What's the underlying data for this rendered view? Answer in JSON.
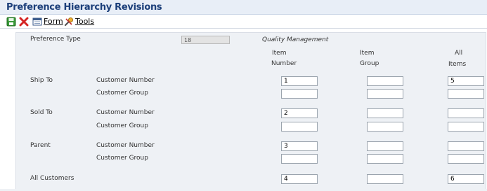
{
  "title": "Preference Hierarchy Revisions",
  "toolbar": {
    "form_label": "Form",
    "tools_label": "Tools"
  },
  "preference": {
    "label": "Preference Type",
    "value": "18",
    "description": "Quality Management"
  },
  "columns": {
    "item_number": [
      "Item",
      "Number"
    ],
    "item_group": [
      "Item",
      "Group"
    ],
    "all_items": [
      "All",
      "Items"
    ]
  },
  "rows": {
    "ship_to": {
      "label": "Ship To",
      "customer_number": {
        "label": "Customer Number",
        "item_number": "1",
        "item_group": "",
        "all_items": "5"
      },
      "customer_group": {
        "label": "Customer Group",
        "item_number": "",
        "item_group": "",
        "all_items": ""
      }
    },
    "sold_to": {
      "label": "Sold To",
      "customer_number": {
        "label": "Customer Number",
        "item_number": "2",
        "item_group": "",
        "all_items": ""
      },
      "customer_group": {
        "label": "Customer Group",
        "item_number": "",
        "item_group": "",
        "all_items": ""
      }
    },
    "parent": {
      "label": "Parent",
      "customer_number": {
        "label": "Customer Number",
        "item_number": "3",
        "item_group": "",
        "all_items": ""
      },
      "customer_group": {
        "label": "Customer Group",
        "item_number": "",
        "item_group": "",
        "all_items": ""
      }
    },
    "all_customers": {
      "label": "All Customers",
      "item_number": "4",
      "item_group": "",
      "all_items": "6"
    }
  }
}
